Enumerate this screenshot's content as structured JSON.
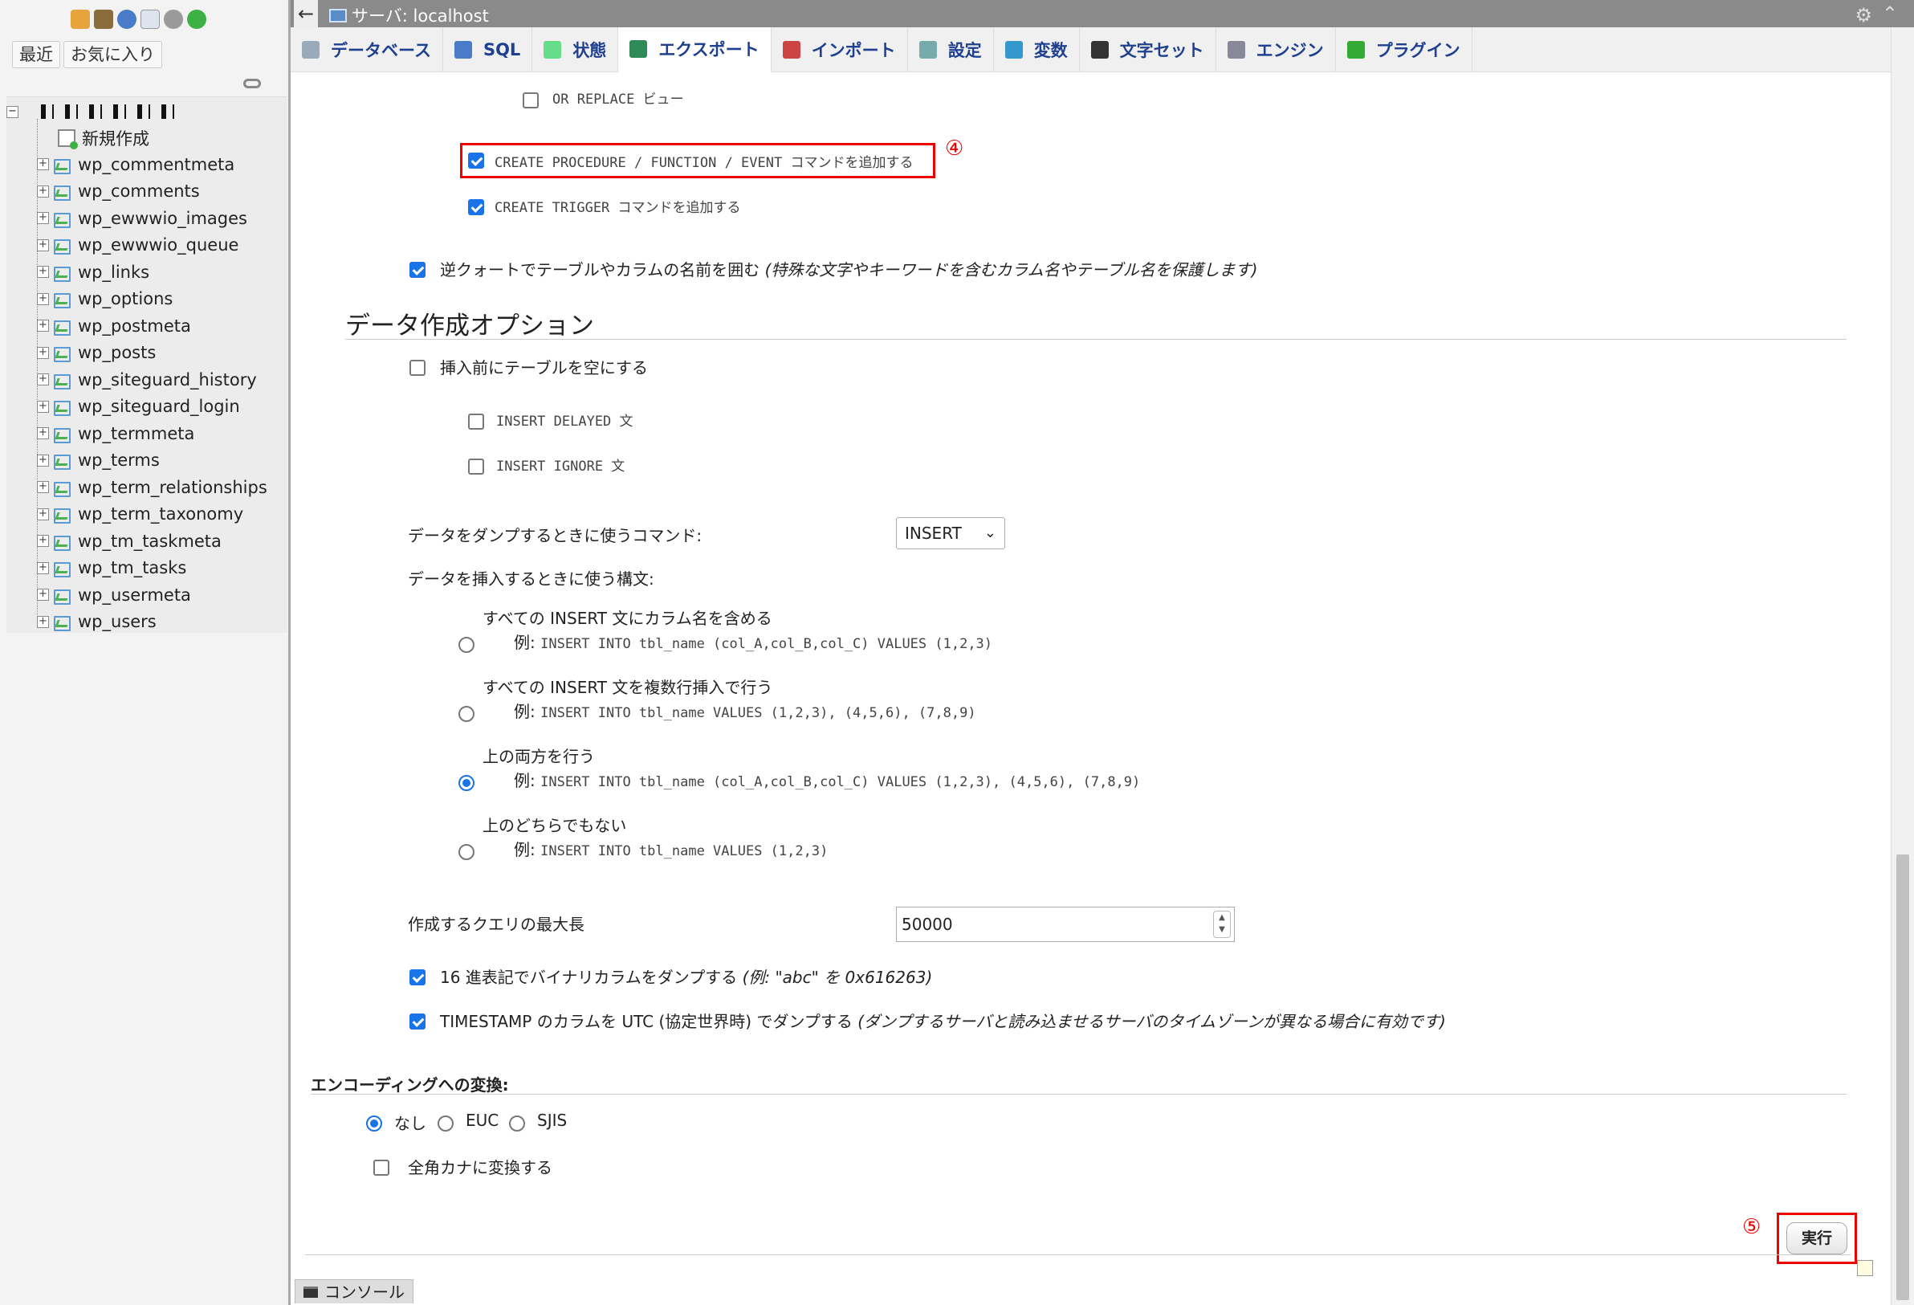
{
  "nav": {
    "tabs": [
      "最近",
      "お気に入り"
    ],
    "new_item": "新規作成",
    "tables": [
      "wp_commentmeta",
      "wp_comments",
      "wp_ewwwio_images",
      "wp_ewwwio_queue",
      "wp_links",
      "wp_options",
      "wp_postmeta",
      "wp_posts",
      "wp_siteguard_history",
      "wp_siteguard_login",
      "wp_termmeta",
      "wp_terms",
      "wp_term_relationships",
      "wp_term_taxonomy",
      "wp_tm_taskmeta",
      "wp_tm_tasks",
      "wp_usermeta",
      "wp_users"
    ]
  },
  "topbar": {
    "server_label": "サーバ: localhost"
  },
  "tabs": [
    "データベース",
    "SQL",
    "状態",
    "エクスポート",
    "インポート",
    "設定",
    "変数",
    "文字セット",
    "エンジン",
    "プラグイン"
  ],
  "tab_icon_colors": [
    "#9ab",
    "#4a7bc8",
    "#6d8",
    "#2e8b57",
    "#c44",
    "#7aa",
    "#39c",
    "#333",
    "#889",
    "#3a3"
  ],
  "options": {
    "or_replace": "OR REPLACE ビュー",
    "create_procedure": "CREATE PROCEDURE / FUNCTION / EVENT コマンドを追加する",
    "create_trigger": "CREATE TRIGGER コマンドを追加する",
    "backquote": "逆クォートでテーブルやカラムの名前を囲む",
    "backquote_hint": "(特殊な文字やキーワードを含むカラム名やテーブル名を保護します)"
  },
  "markers": {
    "step4": "④",
    "step5": "⑤"
  },
  "data_section": {
    "heading": "データ作成オプション",
    "truncate": "挿入前にテーブルを空にする",
    "insert_delayed": "INSERT DELAYED 文",
    "insert_ignore": "INSERT IGNORE 文",
    "dump_command_label": "データをダンプするときに使うコマンド:",
    "dump_command_value": "INSERT",
    "syntax_label": "データを挿入するときに使う構文:",
    "syntax_options": [
      {
        "label": "すべての INSERT 文にカラム名を含める",
        "example_prefix": "例:",
        "example": "INSERT INTO tbl_name (col_A,col_B,col_C) VALUES (1,2,3)"
      },
      {
        "label": "すべての INSERT 文を複数行挿入で行う",
        "example_prefix": "例:",
        "example": "INSERT INTO tbl_name VALUES (1,2,3), (4,5,6), (7,8,9)"
      },
      {
        "label": "上の両方を行う",
        "example_prefix": "例:",
        "example": "INSERT INTO tbl_name (col_A,col_B,col_C) VALUES (1,2,3), (4,5,6), (7,8,9)"
      },
      {
        "label": "上のどちらでもない",
        "example_prefix": "例:",
        "example": "INSERT INTO tbl_name VALUES (1,2,3)"
      }
    ],
    "max_query_label": "作成するクエリの最大長",
    "max_query_value": "50000",
    "hex_label": "16 進表記でバイナリカラムをダンプする",
    "hex_hint": "(例: \"abc\" を 0x616263)",
    "utc_label": "TIMESTAMP のカラムを UTC (協定世界時) でダンプする",
    "utc_hint": "(ダンプするサーバと読み込ませるサーバのタイムゾーンが異なる場合に有効です)"
  },
  "encoding": {
    "heading": "エンコーディングへの変換:",
    "options": [
      "なし",
      "EUC",
      "SJIS"
    ],
    "kana": "全角カナに変換する"
  },
  "go_button": "実行",
  "console": "コンソール"
}
